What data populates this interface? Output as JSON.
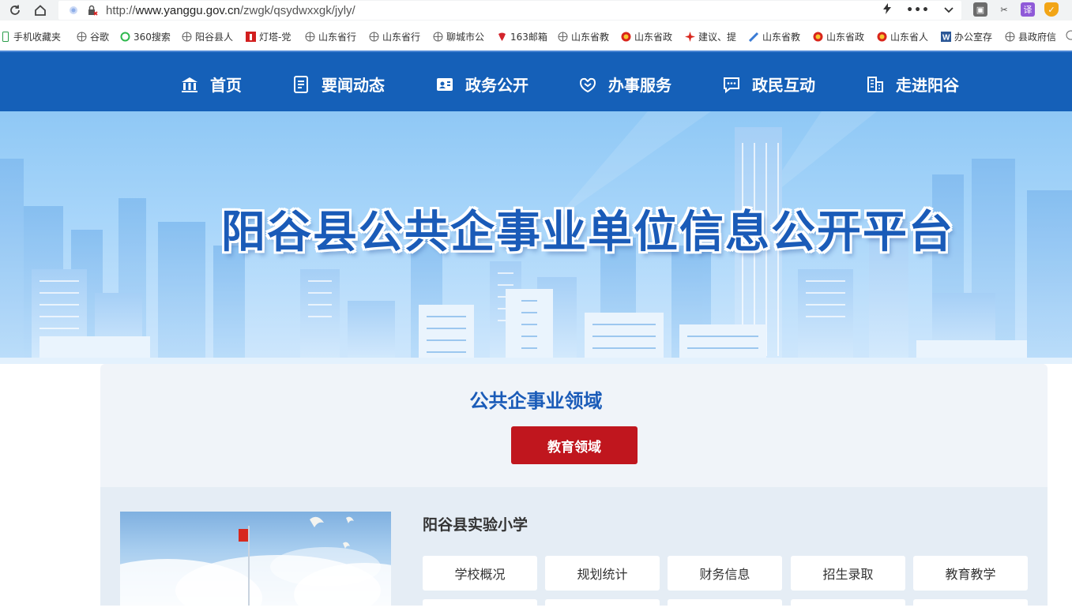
{
  "browser": {
    "url_prefix": "http://",
    "url_host": "www.yanggu.gov.cn",
    "url_path": "/zwgk/qsydwxxgk/jyly/",
    "bookmarks": [
      {
        "label": "手机收藏夹",
        "icon": "phone-icon"
      },
      {
        "label": "谷歌",
        "icon": "globe-icon"
      },
      {
        "label": "360搜索",
        "icon": "search-360-icon"
      },
      {
        "label": "阳谷县人",
        "icon": "globe-icon"
      },
      {
        "label": "灯塔-党",
        "icon": "lighthouse-icon"
      },
      {
        "label": "山东省行",
        "icon": "globe-icon"
      },
      {
        "label": "山东省行",
        "icon": "globe-icon"
      },
      {
        "label": "聊城市公",
        "icon": "globe-icon"
      },
      {
        "label": "163邮箱",
        "icon": "mail-163-icon"
      },
      {
        "label": "山东省教",
        "icon": "globe-icon"
      },
      {
        "label": "山东省政",
        "icon": "emblem-icon"
      },
      {
        "label": "建议、提",
        "icon": "flag-icon"
      },
      {
        "label": "山东省教",
        "icon": "pen-icon"
      },
      {
        "label": "山东省政",
        "icon": "emblem-icon"
      },
      {
        "label": "山东省人",
        "icon": "emblem-icon"
      },
      {
        "label": "办公室存",
        "icon": "word-icon"
      },
      {
        "label": "县政府信",
        "icon": "globe-icon"
      }
    ],
    "translate_label": "译"
  },
  "nav": {
    "items": [
      {
        "label": "首页",
        "icon": "government-building-icon"
      },
      {
        "label": "要闻动态",
        "icon": "document-icon"
      },
      {
        "label": "政务公开",
        "icon": "id-card-icon"
      },
      {
        "label": "办事服务",
        "icon": "handshake-icon"
      },
      {
        "label": "政民互动",
        "icon": "chat-icon"
      },
      {
        "label": "走进阳谷",
        "icon": "city-buildings-icon"
      }
    ]
  },
  "banner": {
    "title": "阳谷县公共企事业单位信息公开平台"
  },
  "content": {
    "section_title": "公共企事业领域",
    "domain_button": "教育领域",
    "school_name": "阳谷县实验小学",
    "tags": [
      "学校概况",
      "规划统计",
      "财务信息",
      "招生录取",
      "教育教学"
    ]
  },
  "colors": {
    "nav_bg": "#1560b8",
    "title_blue": "#1a5bb8",
    "button_red": "#c0161e"
  }
}
